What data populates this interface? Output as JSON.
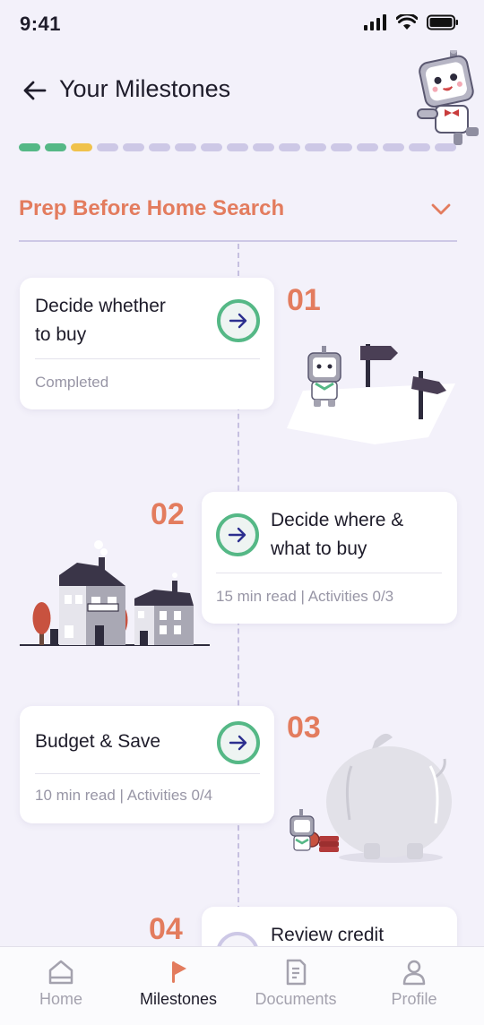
{
  "status": {
    "time": "9:41"
  },
  "header": {
    "title": "Your Milestones"
  },
  "progress": {
    "total_segments": 17,
    "segment_colors": [
      "#55b886",
      "#55b886",
      "#f0c24b"
    ],
    "default_color": "#cdc8e6"
  },
  "section": {
    "title": "Prep Before Home Search"
  },
  "milestones": [
    {
      "number": "01",
      "title_line1": "Decide whether",
      "title_line2": "to buy",
      "meta": "Completed"
    },
    {
      "number": "02",
      "title_line1": "Decide where &",
      "title_line2": "what to buy",
      "meta": "15 min read | Activities 0/3"
    },
    {
      "number": "03",
      "title_line1": "Budget & Save",
      "meta": "10 min read | Activities 0/4"
    },
    {
      "number": "04",
      "title_line1": "Review credit"
    }
  ],
  "nav": {
    "items": [
      {
        "label": "Home",
        "icon": "home-icon"
      },
      {
        "label": "Milestones",
        "icon": "flag-icon",
        "active": true
      },
      {
        "label": "Documents",
        "icon": "document-icon"
      },
      {
        "label": "Profile",
        "icon": "profile-icon"
      }
    ]
  },
  "colors": {
    "accent": "#e37c5e",
    "success": "#55b886",
    "background": "#f3f1fa",
    "timeline": "#c6c0e0"
  }
}
